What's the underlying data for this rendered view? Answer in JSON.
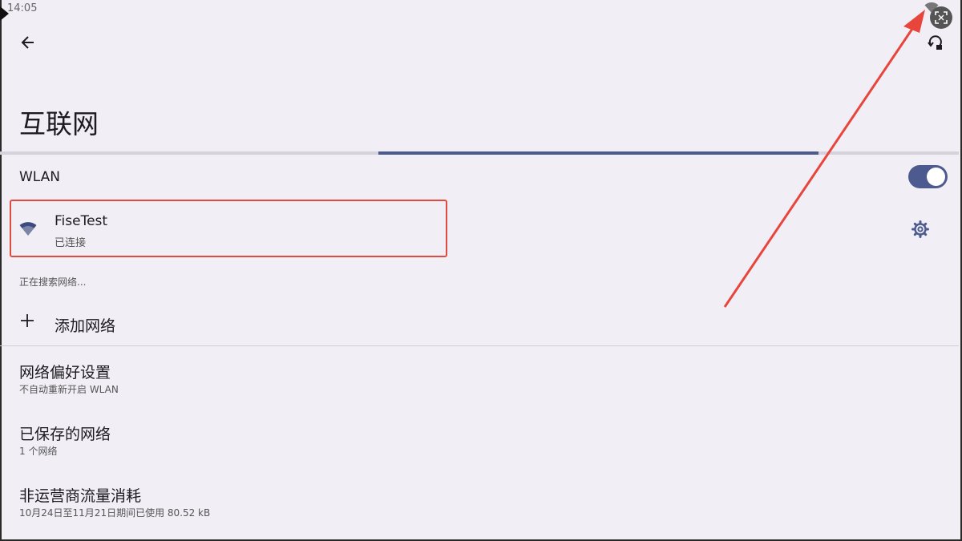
{
  "status_bar": {
    "time": "14:05",
    "wifi_icon": "wifi-icon"
  },
  "toolbar": {
    "back_icon": "arrow-left-icon",
    "rotate_icon": "screen-rotate-icon"
  },
  "page": {
    "title": "互联网"
  },
  "wlan": {
    "label": "WLAN",
    "enabled": true
  },
  "connected_network": {
    "name": "FiseTest",
    "status": "已连接",
    "settings_icon": "gear-icon"
  },
  "searching_text": "正在搜索网络...",
  "add_network": {
    "label": "添加网络",
    "icon": "plus-icon"
  },
  "preferences": [
    {
      "title": "网络偏好设置",
      "subtitle": "不自动重新开启 WLAN"
    },
    {
      "title": "已保存的网络",
      "subtitle": "1 个网络"
    },
    {
      "title": "非运营商流量消耗",
      "subtitle": "10月24日至11月21日期间已使用 80.52 kB"
    }
  ],
  "colors": {
    "accent": "#4c5a8f",
    "background": "#f1eff5",
    "highlight_box": "#e04a3f",
    "annotation_arrow": "#e8453c"
  }
}
